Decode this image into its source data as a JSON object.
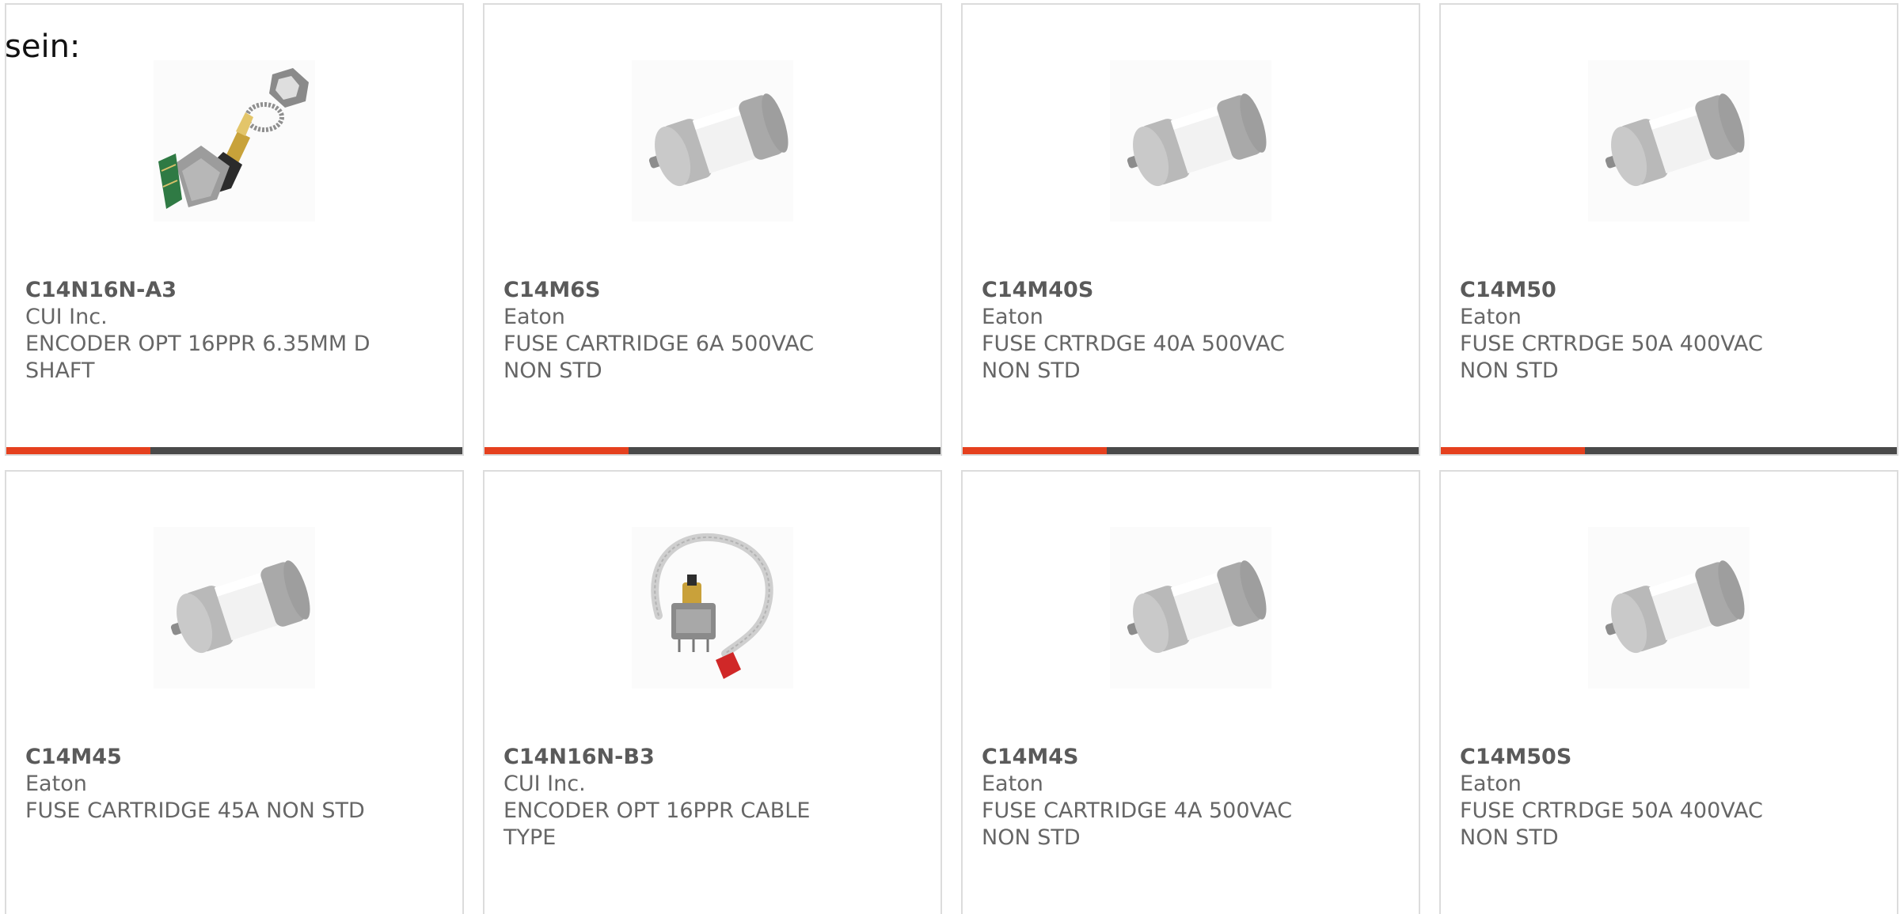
{
  "lead_text": "sein:",
  "colors": {
    "accent": "#e5401e",
    "bar": "#4a4a4a",
    "border": "#dcdcdc",
    "text": "#666666"
  },
  "products": [
    {
      "part_number": "C14N16N-A3",
      "manufacturer": "CUI Inc.",
      "description": "ENCODER OPT 16PPR 6.35MM D SHAFT",
      "image": "optical-encoder-d-shaft-photo"
    },
    {
      "part_number": "C14M6S",
      "manufacturer": "Eaton",
      "description": "FUSE CARTRIDGE 6A 500VAC NON STD",
      "image": "fuse-cartridge-photo"
    },
    {
      "part_number": "C14M40S",
      "manufacturer": "Eaton",
      "description": "FUSE CRTRDGE 40A 500VAC NON STD",
      "image": "fuse-cartridge-photo"
    },
    {
      "part_number": "C14M50",
      "manufacturer": "Eaton",
      "description": "FUSE CRTRDGE 50A 400VAC NON STD",
      "image": "fuse-cartridge-photo"
    },
    {
      "part_number": "C14M45",
      "manufacturer": "Eaton",
      "description": "FUSE CARTRIDGE 45A NON STD",
      "image": "fuse-cartridge-photo"
    },
    {
      "part_number": "C14N16N-B3",
      "manufacturer": "CUI Inc.",
      "description": "ENCODER OPT 16PPR CABLE TYPE",
      "image": "optical-encoder-cable-photo"
    },
    {
      "part_number": "C14M4S",
      "manufacturer": "Eaton",
      "description": "FUSE CARTRIDGE 4A 500VAC NON STD",
      "image": "fuse-cartridge-photo"
    },
    {
      "part_number": "C14M50S",
      "manufacturer": "Eaton",
      "description": "FUSE CRTRDGE 50A 400VAC NON STD",
      "image": "fuse-cartridge-photo"
    }
  ]
}
